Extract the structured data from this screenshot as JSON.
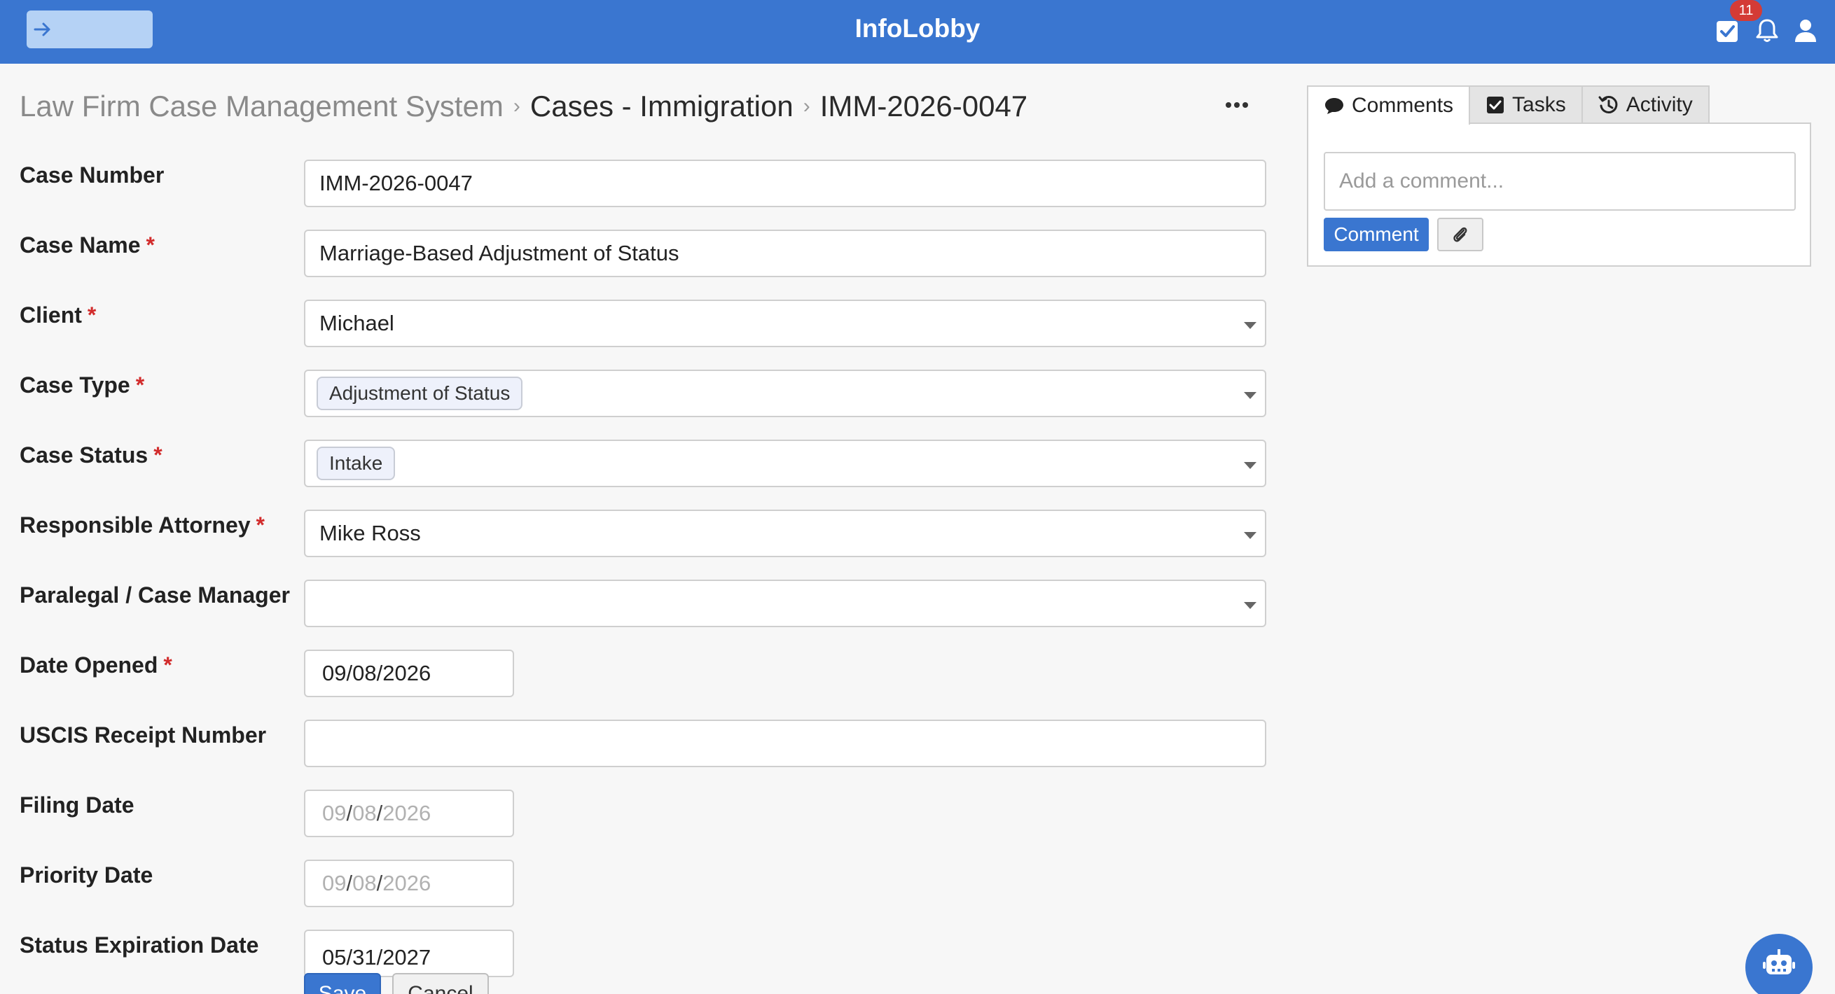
{
  "header": {
    "app_title": "InfoLobby",
    "notification_count": "11",
    "icons": [
      "arrow-right-icon",
      "check-square-icon",
      "bell-icon",
      "user-icon"
    ]
  },
  "breadcrumb": {
    "root": "Law Firm Case Management System",
    "section": "Cases - Immigration",
    "current": "IMM-2026-0047"
  },
  "form": {
    "case_number": {
      "label": "Case Number",
      "value": "IMM-2026-0047"
    },
    "case_name": {
      "label": "Case Name",
      "value": "Marriage-Based Adjustment of Status"
    },
    "client": {
      "label": "Client",
      "value": "Michael"
    },
    "case_type": {
      "label": "Case Type",
      "value": "Adjustment of Status"
    },
    "case_status": {
      "label": "Case Status",
      "value": "Intake"
    },
    "responsible_attorney": {
      "label": "Responsible Attorney",
      "value": "Mike Ross"
    },
    "paralegal": {
      "label": "Paralegal / Case Manager",
      "value": ""
    },
    "date_opened": {
      "label": "Date Opened",
      "month": "09",
      "day": "08",
      "year": "2026"
    },
    "uscis_receipt": {
      "label": "USCIS Receipt Number",
      "value": ""
    },
    "filing_date": {
      "label": "Filing Date",
      "month": "09",
      "day": "08",
      "year": "2026"
    },
    "priority_date": {
      "label": "Priority Date",
      "month": "09",
      "day": "08",
      "year": "2026"
    },
    "status_expiration": {
      "label": "Status Expiration Date",
      "value": "05/31/2027"
    },
    "required_marker": "*",
    "date_separator": "/",
    "save_label": "Save",
    "cancel_label": "Cancel"
  },
  "panel": {
    "tabs": [
      {
        "label": "Comments",
        "icon": "comment-icon"
      },
      {
        "label": "Tasks",
        "icon": "check-square-icon"
      },
      {
        "label": "Activity",
        "icon": "history-icon"
      }
    ],
    "comment_placeholder": "Add a comment...",
    "comment_button": "Comment"
  },
  "colors": {
    "brand": "#3a76d0",
    "required": "#d22c2c",
    "badge": "#d43b36"
  }
}
